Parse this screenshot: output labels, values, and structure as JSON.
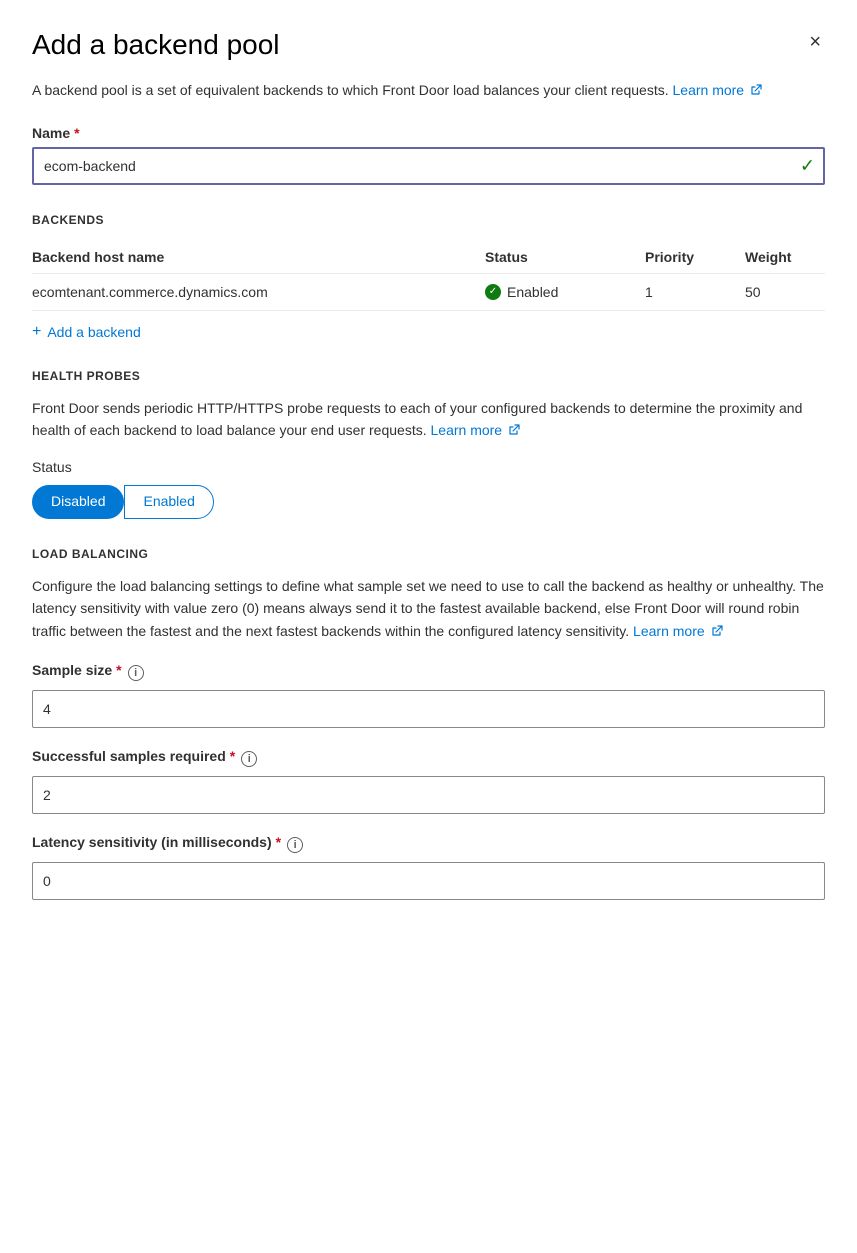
{
  "panel": {
    "title": "Add a backend pool",
    "close_label": "×"
  },
  "description": {
    "text": "A backend pool is a set of equivalent backends to which Front Door load balances your client requests.",
    "link_text": "Learn more",
    "link_href": "#"
  },
  "name_field": {
    "label": "Name",
    "required": true,
    "value": "ecom-backend",
    "placeholder": ""
  },
  "backends_section": {
    "heading": "BACKENDS",
    "table": {
      "columns": [
        "Backend host name",
        "Status",
        "Priority",
        "Weight"
      ],
      "rows": [
        {
          "host": "ecomtenant.commerce.dynamics.com",
          "status": "Enabled",
          "priority": "1",
          "weight": "50"
        }
      ]
    },
    "add_label": "Add a backend"
  },
  "health_probes_section": {
    "heading": "HEALTH PROBES",
    "description": "Front Door sends periodic HTTP/HTTPS probe requests to each of your configured backends to determine the proximity and health of each backend to load balance your end user requests.",
    "learn_more_text": "Learn more",
    "status_label": "Status",
    "toggle": {
      "disabled_label": "Disabled",
      "enabled_label": "Enabled",
      "active": "disabled"
    }
  },
  "load_balancing_section": {
    "heading": "LOAD BALANCING",
    "description": "Configure the load balancing settings to define what sample set we need to use to call the backend as healthy or unhealthy. The latency sensitivity with value zero (0) means always send it to the fastest available backend, else Front Door will round robin traffic between the fastest and the next fastest backends within the configured latency sensitivity.",
    "learn_more_text": "Learn more",
    "fields": {
      "sample_size": {
        "label": "Sample size",
        "required": true,
        "value": "4"
      },
      "successful_samples": {
        "label": "Successful samples required",
        "required": true,
        "value": "2"
      },
      "latency_sensitivity": {
        "label": "Latency sensitivity (in milliseconds)",
        "required": true,
        "value": "0"
      }
    }
  }
}
